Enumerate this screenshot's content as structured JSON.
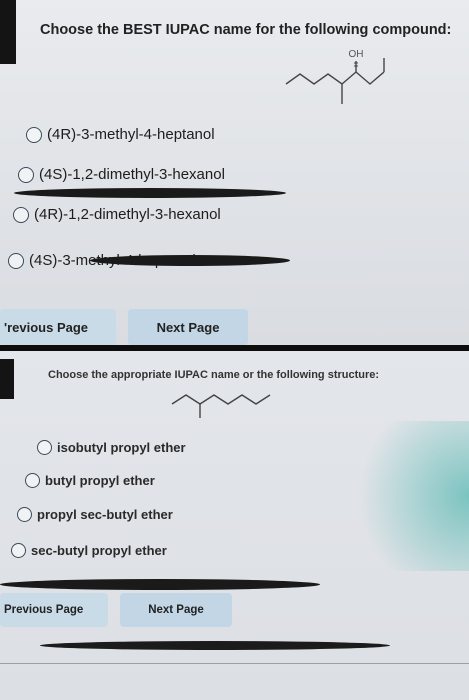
{
  "screenshot_1": {
    "question": "Choose the BEST IUPAC name for the following compound:",
    "molecule": {
      "label": "OH",
      "icon": "skeletal-structure-icon"
    },
    "options": [
      "(4R)-3-methyl-4-heptanol",
      "(4S)-1,2-dimethyl-3-hexanol",
      "(4R)-1,2-dimethyl-3-hexanol",
      "(4S)-3-methyl-4-heptanol"
    ],
    "prev_button": "'revious Page",
    "next_button": "Next Page"
  },
  "screenshot_2": {
    "question": "Choose the appropriate IUPAC name or the following structure:",
    "molecule": {
      "icon": "ether-skeletal-structure-icon"
    },
    "options": [
      "isobutyl propyl ether",
      "butyl propyl ether",
      "propyl sec-butyl ether",
      "sec-butyl propyl ether"
    ],
    "prev_button": "Previous Page",
    "next_button": "Next Page"
  },
  "colors": {
    "button_bg": "#c2d6e6",
    "panel_bg": "#e1e4e8",
    "radio_border": "#3a4a58"
  }
}
